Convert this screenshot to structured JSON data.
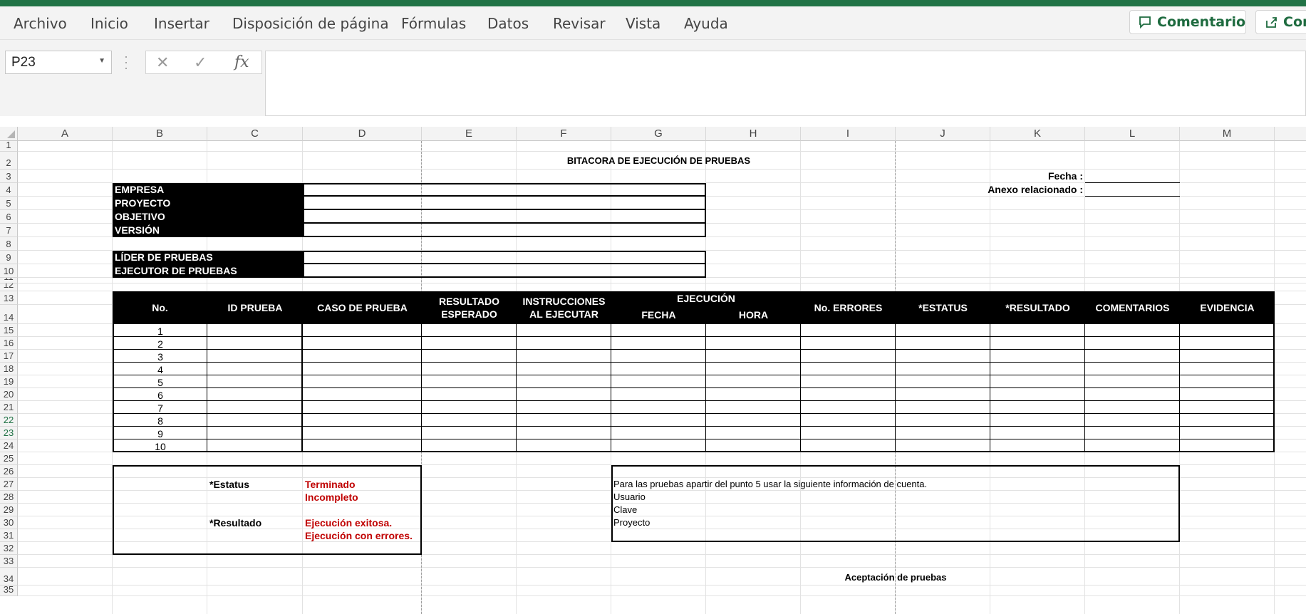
{
  "menu": {
    "items": [
      "Archivo",
      "Inicio",
      "Insertar",
      "Disposición de página",
      "Fórmulas",
      "Datos",
      "Revisar",
      "Vista",
      "Ayuda"
    ],
    "comments_button": "Comentarios",
    "share_button": "Compartir"
  },
  "formula_bar": {
    "name_box": "P23",
    "cancel_symbol": "✕",
    "enter_symbol": "✓",
    "fx_symbol": "fx",
    "content": ""
  },
  "grid": {
    "columns": [
      "A",
      "B",
      "C",
      "D",
      "E",
      "F",
      "G",
      "H",
      "I",
      "J",
      "K",
      "L",
      "M"
    ],
    "rows": [
      "1",
      "2",
      "3",
      "4",
      "5",
      "6",
      "7",
      "8",
      "9",
      "10",
      "11",
      "12",
      "13",
      "14",
      "15",
      "16",
      "17",
      "18",
      "19",
      "20",
      "21",
      "22",
      "23",
      "24",
      "25",
      "26",
      "27",
      "28",
      "29",
      "30",
      "31",
      "32",
      "33",
      "34",
      "35"
    ],
    "selected_rows": [
      "22",
      "23"
    ]
  },
  "sheet": {
    "title": "BITACORA DE EJECUCIÓN DE PRUEBAS",
    "fecha_label": "Fecha  :",
    "anexo_label": "Anexo relacionado :",
    "info_labels": [
      "EMPRESA",
      "PROYECTO",
      "OBJETIVO",
      "VERSIÓN"
    ],
    "lead_labels": [
      "LÍDER DE PRUEBAS",
      "EJECUTOR DE PRUEBAS"
    ],
    "headers": {
      "no": "No.",
      "id_prueba": "ID PRUEBA",
      "caso_prueba": "CASO DE PRUEBA",
      "resultado_esperado": "RESULTADO ESPERADO",
      "instrucciones": "INSTRUCCIONES AL EJECUTAR",
      "ejecucion": "EJECUCIÓN",
      "fecha": "FECHA",
      "hora": "HORA",
      "no_errores": "No. ERRORES",
      "estatus": "*ESTATUS",
      "resultado": "*RESULTADO",
      "comentarios": "COMENTARIOS",
      "evidencia": "EVIDENCIA"
    },
    "row_numbers": [
      "1",
      "2",
      "3",
      "4",
      "5",
      "6",
      "7",
      "8",
      "9",
      "10"
    ],
    "legend": {
      "estatus_label": "*Estatus",
      "estatus_values": [
        "Terminado",
        "Incompleto"
      ],
      "resultado_label": "*Resultado",
      "resultado_values": [
        "Ejecución exitosa.",
        "Ejecución con errores."
      ]
    },
    "note_lines": [
      "Para las pruebas apartir del punto 5 usar la siguiente información de cuenta.",
      "Usuario",
      "Clave",
      "Proyecto"
    ],
    "acceptance_title": "Aceptación de pruebas"
  }
}
